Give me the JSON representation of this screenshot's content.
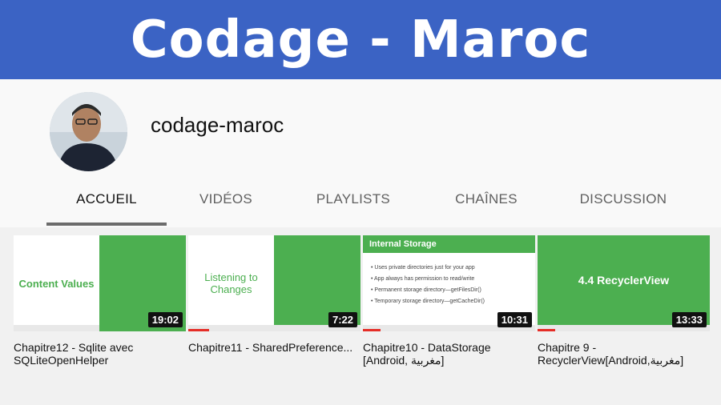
{
  "banner": {
    "title": "Codage - Maroc"
  },
  "channel": {
    "name": "codage-maroc"
  },
  "tabs": [
    {
      "label": "ACCUEIL",
      "active": true
    },
    {
      "label": "VIDÉOS",
      "active": false
    },
    {
      "label": "PLAYLISTS",
      "active": false
    },
    {
      "label": "CHAÎNES",
      "active": false
    },
    {
      "label": "DISCUSSION",
      "active": false
    }
  ],
  "videos": [
    {
      "thumb_text": "Content Values",
      "duration": "19:02",
      "title": "Chapitre12 - Sqlite avec SQLiteOpenHelper",
      "progress": 0
    },
    {
      "thumb_text": "Listening to Changes",
      "duration": "7:22",
      "title": "Chapitre11 - SharedPreference...",
      "progress": 0.12
    },
    {
      "thumb_text": "Internal Storage",
      "duration": "10:31",
      "title": "Chapitre10 - DataStorage [Android, مغربية]",
      "progress": 0.1,
      "bullets": [
        "Uses private directories just for your app",
        "App always has permission to read/write",
        "Permanent storage directory—getFilesDir()",
        "Temporary storage directory—getCacheDir()"
      ]
    },
    {
      "thumb_text": "4.4 RecyclerView",
      "duration": "13:33",
      "title": "Chapitre 9 - RecyclerView[Android,مغربية]",
      "progress": 0.1
    }
  ],
  "colors": {
    "banner": "#3b63c4",
    "thumb_green": "#4caf50",
    "thumb_text_green": "#4caf50"
  }
}
